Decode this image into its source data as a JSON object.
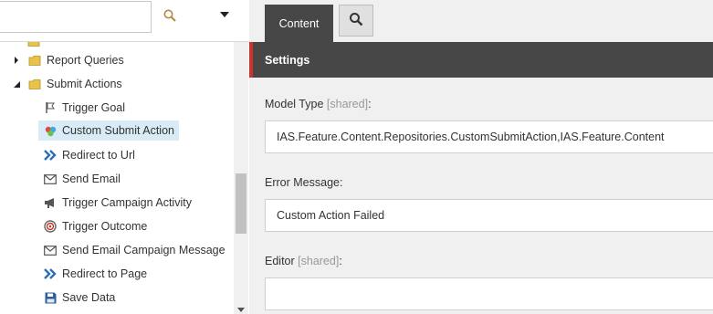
{
  "search": {
    "value": "",
    "placeholder": ""
  },
  "tree": {
    "items": [
      {
        "label": "Report Queries",
        "icon": "folder-icon",
        "expanded": false
      },
      {
        "label": "Submit Actions",
        "icon": "folder-icon",
        "expanded": true
      },
      {
        "label": "Trigger Goal",
        "icon": "goal-flag-icon"
      },
      {
        "label": "Custom Submit Action",
        "icon": "palette-icon",
        "selected": true
      },
      {
        "label": "Redirect to Url",
        "icon": "double-chevron-icon"
      },
      {
        "label": "Send Email",
        "icon": "envelope-icon"
      },
      {
        "label": "Trigger Campaign Activity",
        "icon": "megaphone-icon"
      },
      {
        "label": "Trigger Outcome",
        "icon": "target-icon"
      },
      {
        "label": "Send Email Campaign Message",
        "icon": "envelope-icon"
      },
      {
        "label": "Redirect to Page",
        "icon": "double-chevron-icon"
      },
      {
        "label": "Save Data",
        "icon": "floppy-disk-icon"
      }
    ]
  },
  "editor": {
    "tabs": {
      "content": "Content"
    },
    "section_title": "Settings",
    "fields": [
      {
        "label": "Model Type",
        "shared": "[shared]",
        "suffix": ":",
        "value": "IAS.Feature.Content.Repositories.CustomSubmitAction,IAS.Feature.Content"
      },
      {
        "label": "Error Message:",
        "value": "Custom Action Failed"
      },
      {
        "label": "Editor",
        "shared": "[shared]",
        "suffix": ":",
        "value": ""
      }
    ]
  },
  "colors": {
    "dark_bar": "#474747",
    "accent_red": "#d0312d",
    "selection": "#d8ebf6",
    "panel_bg": "#f0f0f0"
  }
}
